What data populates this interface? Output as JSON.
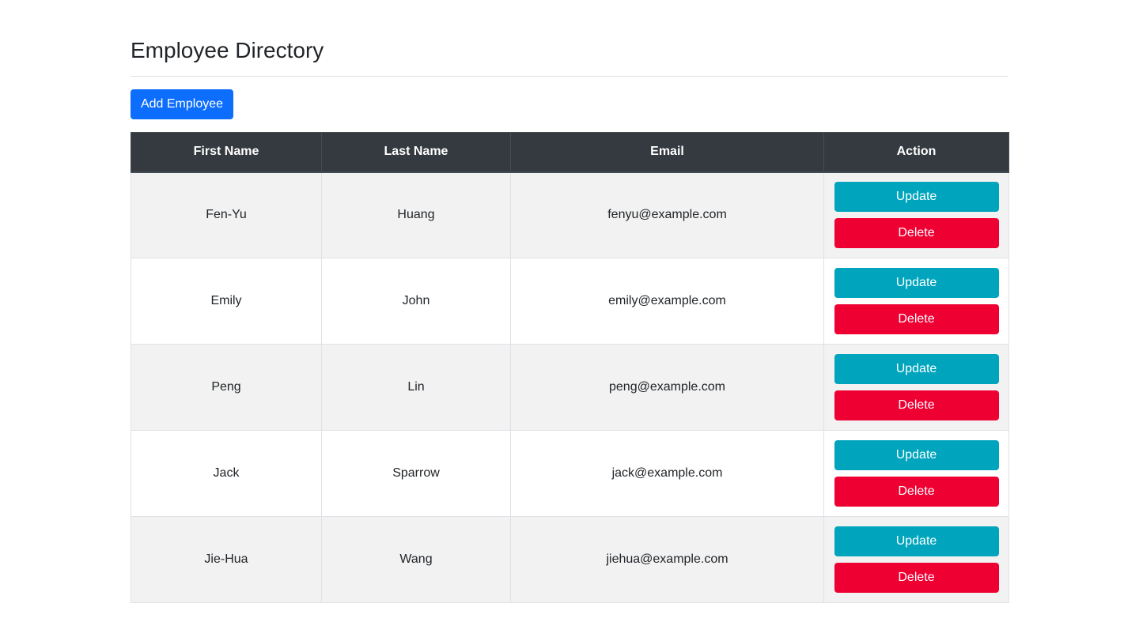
{
  "page": {
    "title": "Employee Directory",
    "add_button_label": "Add Employee"
  },
  "table": {
    "headers": [
      "First Name",
      "Last Name",
      "Email",
      "Action"
    ],
    "rows": [
      {
        "first_name": "Fen-Yu",
        "last_name": "Huang",
        "email": "fenyu@example.com",
        "update_label": "Update",
        "delete_label": "Delete"
      },
      {
        "first_name": "Emily",
        "last_name": "John",
        "email": "emily@example.com",
        "update_label": "Update",
        "delete_label": "Delete"
      },
      {
        "first_name": "Peng",
        "last_name": "Lin",
        "email": "peng@example.com",
        "update_label": "Update",
        "delete_label": "Delete"
      },
      {
        "first_name": "Jack",
        "last_name": "Sparrow",
        "email": "jack@example.com",
        "update_label": "Update",
        "delete_label": "Delete"
      },
      {
        "first_name": "Jie-Hua",
        "last_name": "Wang",
        "email": "jiehua@example.com",
        "update_label": "Update",
        "delete_label": "Delete"
      }
    ]
  },
  "colors": {
    "primary": "#0d6efd",
    "info": "#00a5bd",
    "danger": "#ee0033",
    "header_bg": "#343a40",
    "stripe": "#f2f2f2"
  }
}
